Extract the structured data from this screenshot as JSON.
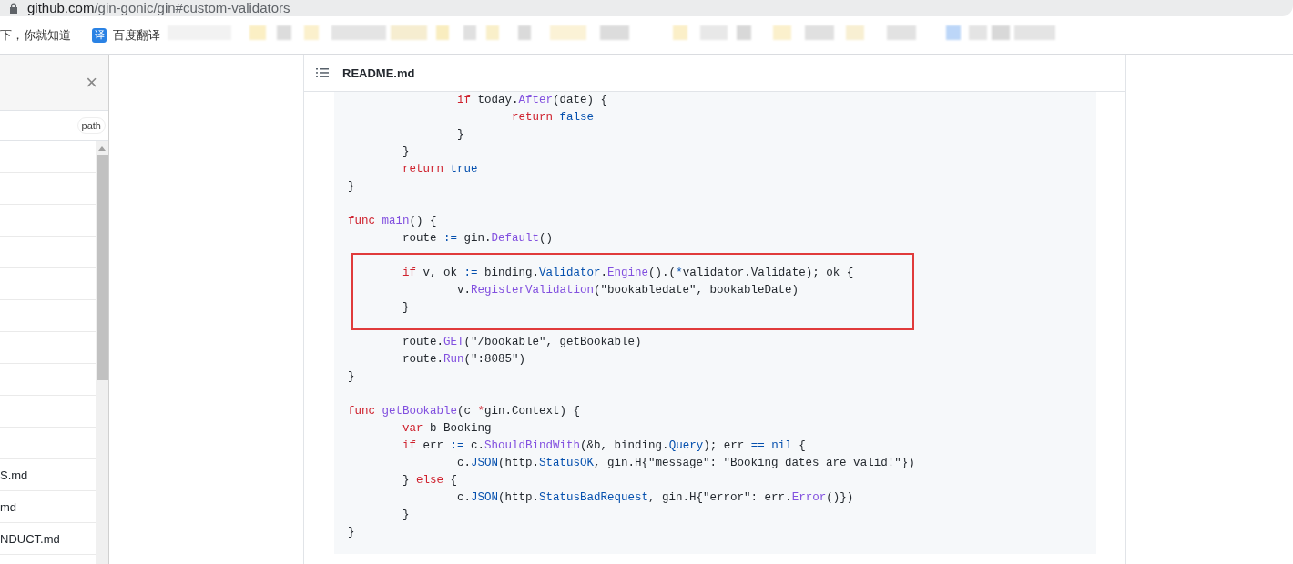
{
  "address_bar": {
    "host": "github.com",
    "path": "/gin-gonic/gin#custom-validators"
  },
  "bookmarks": [
    {
      "label": "下，你就知道"
    },
    {
      "icon_text": "译",
      "label": "百度翻译"
    }
  ],
  "sidebar": {
    "close": "×",
    "filter_tag": "path",
    "files": [
      "S.md",
      "md",
      "NDUCT.md"
    ]
  },
  "readme": {
    "title": "README.md",
    "lines": [
      {
        "kind": "code",
        "tokens": [
          {
            "text": "                if",
            "kind": "kw"
          },
          {
            "text": " today."
          },
          {
            "text": "After",
            "kind": "fn"
          },
          {
            "text": "(date) {"
          }
        ]
      },
      {
        "kind": "code",
        "tokens": [
          {
            "text": "                        return",
            "kind": "kw"
          },
          {
            "text": " false",
            "kind": "const"
          }
        ]
      },
      {
        "kind": "code",
        "tokens": [
          {
            "text": "                }"
          }
        ]
      },
      {
        "kind": "code",
        "tokens": [
          {
            "text": "        }"
          }
        ]
      },
      {
        "kind": "code",
        "tokens": [
          {
            "text": "        return",
            "kind": "kw"
          },
          {
            "text": " true",
            "kind": "const"
          }
        ]
      },
      {
        "kind": "code",
        "tokens": [
          {
            "text": "}"
          }
        ]
      },
      {
        "kind": "blank"
      },
      {
        "kind": "code",
        "tokens": [
          {
            "text": "func",
            "kind": "kw"
          },
          {
            "text": " main",
            "kind": "fn"
          },
          {
            "text": "() {"
          }
        ]
      },
      {
        "kind": "code",
        "tokens": [
          {
            "text": "        route "
          },
          {
            "text": ":=",
            "kind": "const"
          },
          {
            "text": " gin."
          },
          {
            "text": "Default",
            "kind": "fn"
          },
          {
            "text": "()"
          }
        ]
      },
      {
        "kind": "blank"
      },
      {
        "kind": "code",
        "tokens": [
          {
            "text": "        if",
            "kind": "kw"
          },
          {
            "text": " v, ok "
          },
          {
            "text": ":=",
            "kind": "const"
          },
          {
            "text": " binding."
          },
          {
            "text": "Validator",
            "kind": "const"
          },
          {
            "text": "."
          },
          {
            "text": "Engine",
            "kind": "fn"
          },
          {
            "text": "().("
          },
          {
            "text": "*",
            "kind": "const"
          },
          {
            "text": "validator.Validate); ok {"
          }
        ]
      },
      {
        "kind": "code",
        "tokens": [
          {
            "text": "                v."
          },
          {
            "text": "RegisterValidation",
            "kind": "fn"
          },
          {
            "text": "(\"bookabledate\", bookableDate)"
          }
        ]
      },
      {
        "kind": "code",
        "tokens": [
          {
            "text": "        }"
          }
        ]
      },
      {
        "kind": "blank"
      },
      {
        "kind": "code",
        "tokens": [
          {
            "text": "        route."
          },
          {
            "text": "GET",
            "kind": "fn"
          },
          {
            "text": "(\"/bookable\", getBookable)"
          }
        ]
      },
      {
        "kind": "code",
        "tokens": [
          {
            "text": "        route."
          },
          {
            "text": "Run",
            "kind": "fn"
          },
          {
            "text": "(\":8085\")"
          }
        ]
      },
      {
        "kind": "code",
        "tokens": [
          {
            "text": "}"
          }
        ]
      },
      {
        "kind": "blank"
      },
      {
        "kind": "code",
        "tokens": [
          {
            "text": "func",
            "kind": "kw"
          },
          {
            "text": " getBookable",
            "kind": "fn"
          },
          {
            "text": "(c "
          },
          {
            "text": "*",
            "kind": "kw"
          },
          {
            "text": "gin.Context) {"
          }
        ]
      },
      {
        "kind": "code",
        "tokens": [
          {
            "text": "        var",
            "kind": "kw"
          },
          {
            "text": " b Booking"
          }
        ]
      },
      {
        "kind": "code",
        "tokens": [
          {
            "text": "        if",
            "kind": "kw"
          },
          {
            "text": " err "
          },
          {
            "text": ":=",
            "kind": "const"
          },
          {
            "text": " c."
          },
          {
            "text": "ShouldBindWith",
            "kind": "fn"
          },
          {
            "text": "(&b, binding."
          },
          {
            "text": "Query",
            "kind": "const"
          },
          {
            "text": "); err "
          },
          {
            "text": "==",
            "kind": "const"
          },
          {
            "text": " nil",
            "kind": "const"
          },
          {
            "text": " {"
          }
        ]
      },
      {
        "kind": "code",
        "tokens": [
          {
            "text": "                c."
          },
          {
            "text": "JSON",
            "kind": "const"
          },
          {
            "text": "(http."
          },
          {
            "text": "StatusOK",
            "kind": "const"
          },
          {
            "text": ", gin.H{\"message\": \"Booking dates are valid!\"})"
          }
        ]
      },
      {
        "kind": "code",
        "tokens": [
          {
            "text": "        } "
          },
          {
            "text": "else",
            "kind": "kw"
          },
          {
            "text": " {"
          }
        ]
      },
      {
        "kind": "code",
        "tokens": [
          {
            "text": "                c."
          },
          {
            "text": "JSON",
            "kind": "const"
          },
          {
            "text": "(http."
          },
          {
            "text": "StatusBadRequest",
            "kind": "const"
          },
          {
            "text": ", gin.H{\"error\": err."
          },
          {
            "text": "Error",
            "kind": "fn"
          },
          {
            "text": "()})"
          }
        ]
      },
      {
        "kind": "code",
        "tokens": [
          {
            "text": "        }"
          }
        ]
      },
      {
        "kind": "code",
        "tokens": [
          {
            "text": "}"
          }
        ]
      }
    ]
  }
}
